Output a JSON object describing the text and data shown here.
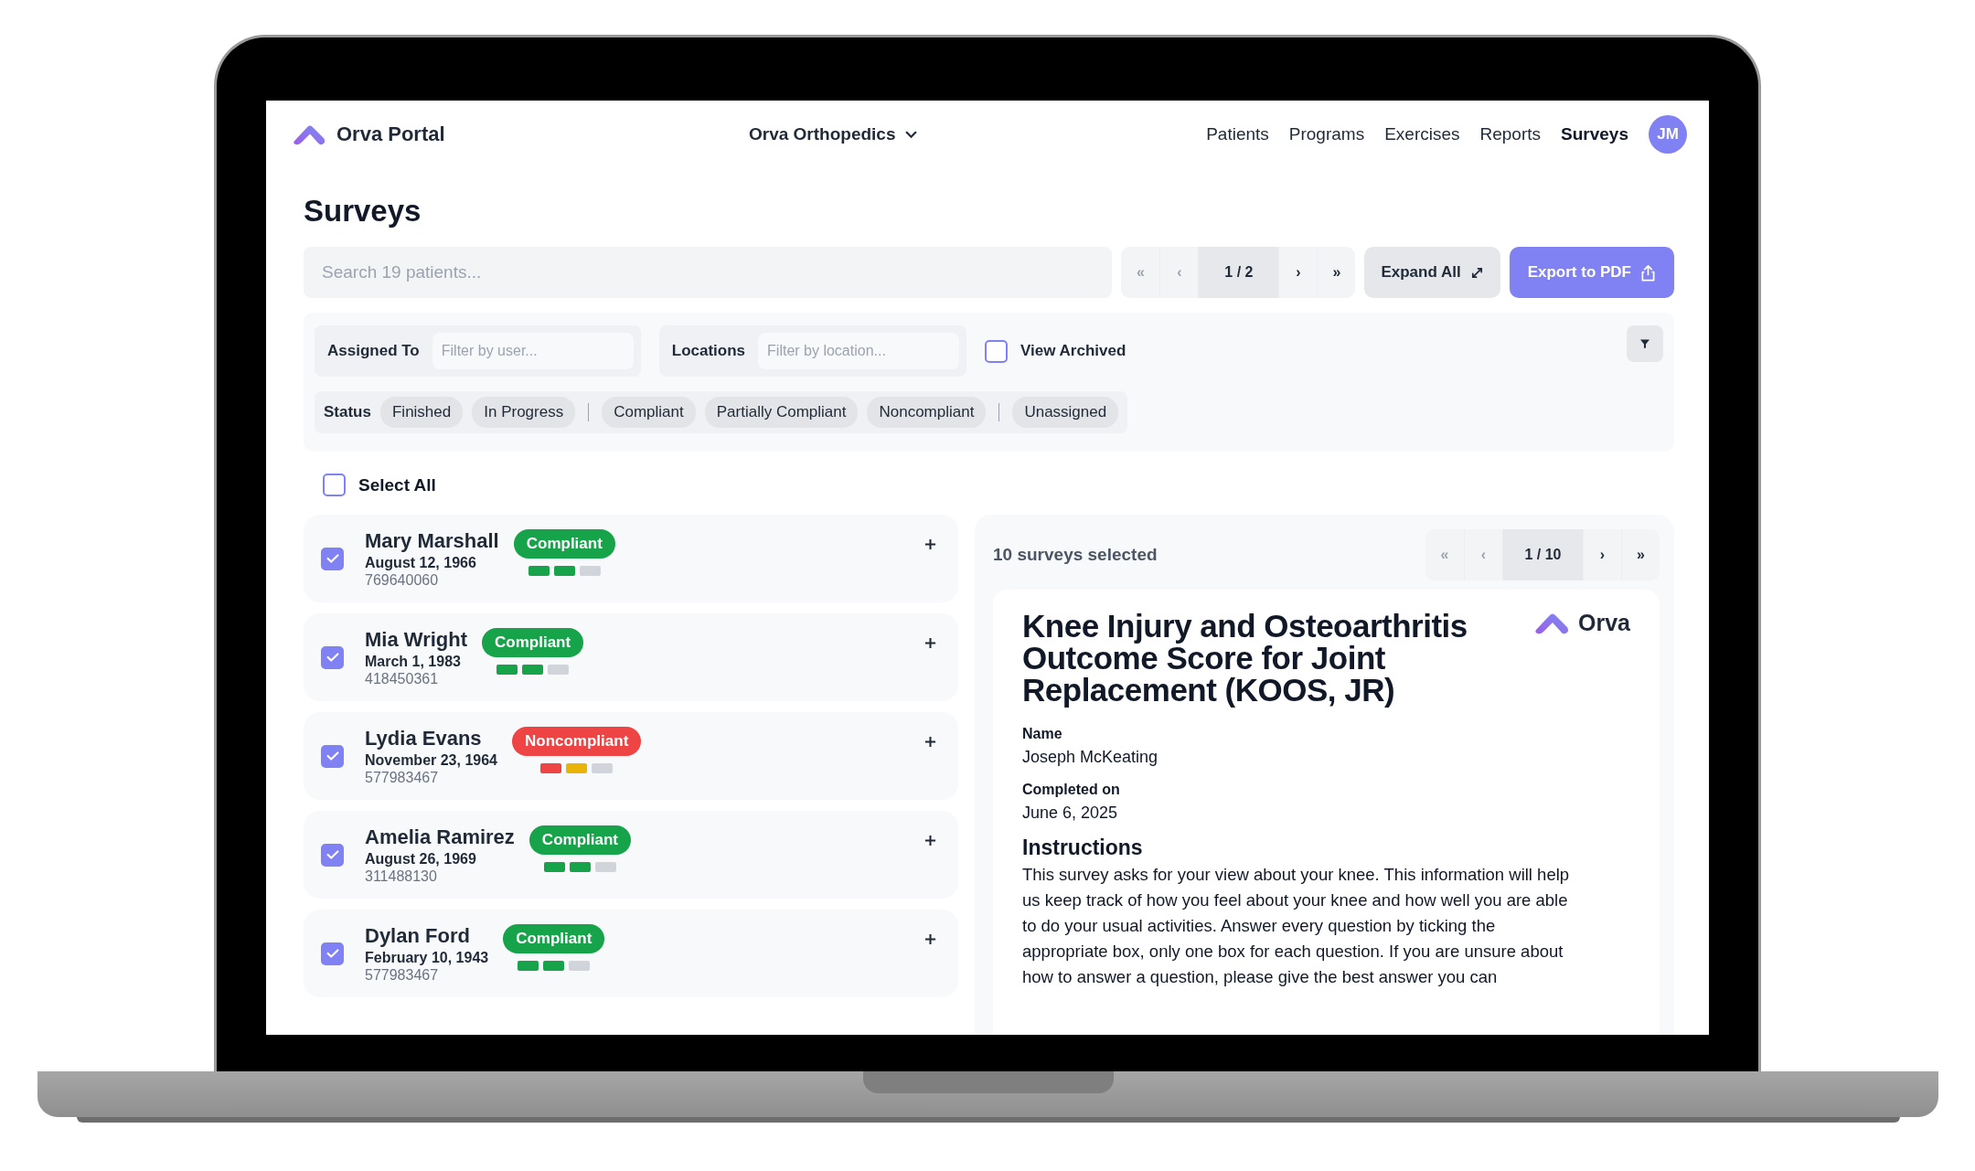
{
  "app": {
    "name": "Orva Portal"
  },
  "org_selector": {
    "label": "Orva Orthopedics"
  },
  "nav": [
    {
      "label": "Patients",
      "selected": false
    },
    {
      "label": "Programs",
      "selected": false
    },
    {
      "label": "Exercises",
      "selected": false
    },
    {
      "label": "Reports",
      "selected": false
    },
    {
      "label": "Surveys",
      "selected": true
    }
  ],
  "user": {
    "initials": "JM"
  },
  "page": {
    "title": "Surveys"
  },
  "search": {
    "placeholder": "Search 19 patients..."
  },
  "pager": [
    {
      "label": "«",
      "kind": "nav",
      "disabled": true
    },
    {
      "label": "‹",
      "kind": "nav",
      "disabled": true
    },
    {
      "label": "1 / 2",
      "kind": "page",
      "disabled": false
    },
    {
      "label": "›",
      "kind": "nav",
      "disabled": false
    },
    {
      "label": "»",
      "kind": "nav",
      "disabled": false
    }
  ],
  "actions": [
    {
      "label": "Expand All",
      "kind": "expand"
    },
    {
      "label": "Export to PDF",
      "kind": "export"
    }
  ],
  "filters": {
    "assigned_to": {
      "label": "Assigned To",
      "placeholder": "Filter by user..."
    },
    "locations": {
      "label": "Locations",
      "placeholder": "Filter by location..."
    },
    "view_archived": {
      "label": "View Archived",
      "checked": false
    },
    "status": {
      "label": "Status",
      "groups": [
        [
          "Finished",
          "In Progress"
        ],
        [
          "Compliant",
          "Partially Compliant",
          "Noncompliant"
        ],
        [
          "Unassigned"
        ]
      ]
    }
  },
  "select_all": {
    "label": "Select All",
    "checked": false
  },
  "patients": [
    {
      "name": "Mary Marshall",
      "dob": "August 12, 1966",
      "id": "769640060",
      "checked": true,
      "status": {
        "label": "Compliant",
        "kind": "compliant"
      },
      "segments": [
        {
          "color": "#16a34a"
        },
        {
          "color": "#16a34a"
        },
        {
          "color": "#d1d5db"
        }
      ]
    },
    {
      "name": "Mia Wright",
      "dob": "March 1, 1983",
      "id": "418450361",
      "checked": true,
      "status": {
        "label": "Compliant",
        "kind": "compliant"
      },
      "segments": [
        {
          "color": "#16a34a"
        },
        {
          "color": "#16a34a"
        },
        {
          "color": "#d1d5db"
        }
      ]
    },
    {
      "name": "Lydia Evans",
      "dob": "November 23, 1964",
      "id": "577983467",
      "checked": true,
      "status": {
        "label": "Noncompliant",
        "kind": "noncompliant"
      },
      "segments": [
        {
          "color": "#ef4444"
        },
        {
          "color": "#eab308"
        },
        {
          "color": "#d1d5db"
        }
      ]
    },
    {
      "name": "Amelia Ramirez",
      "dob": "August 26, 1969",
      "id": "311488130",
      "checked": true,
      "status": {
        "label": "Compliant",
        "kind": "compliant"
      },
      "segments": [
        {
          "color": "#16a34a"
        },
        {
          "color": "#16a34a"
        },
        {
          "color": "#d1d5db"
        }
      ]
    },
    {
      "name": "Dylan Ford",
      "dob": "February 10, 1943",
      "id": "577983467",
      "checked": true,
      "status": {
        "label": "Compliant",
        "kind": "compliant"
      },
      "segments": [
        {
          "color": "#16a34a"
        },
        {
          "color": "#16a34a"
        },
        {
          "color": "#d1d5db"
        }
      ]
    }
  ],
  "survey_panel": {
    "selected_count": "10 surveys selected",
    "pager": [
      {
        "label": "«",
        "kind": "nav",
        "disabled": true
      },
      {
        "label": "‹",
        "kind": "nav",
        "disabled": true
      },
      {
        "label": "1 / 10",
        "kind": "page",
        "disabled": false
      },
      {
        "label": "›",
        "kind": "nav",
        "disabled": false
      },
      {
        "label": "»",
        "kind": "nav",
        "disabled": false
      }
    ],
    "document": {
      "title": "Knee Injury and Osteoarthritis Outcome Score for Joint Replacement (KOOS, JR)",
      "brand": "Orva",
      "fields": [
        {
          "label": "Name",
          "value": "Joseph McKeating"
        },
        {
          "label": "Completed on",
          "value": "June 6, 2025"
        }
      ],
      "section": {
        "heading": "Instructions",
        "text": "This survey asks for your view about your knee. This information will help us keep track of how you feel about your knee and how well you are able to do your usual activities. Answer every question by ticking the appropriate box, only one box for each question. If you are unsure about how to answer a question, please give the best answer you can"
      }
    }
  }
}
